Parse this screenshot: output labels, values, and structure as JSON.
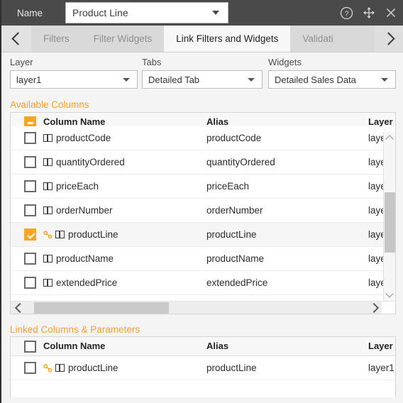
{
  "titlebar": {
    "name_label": "Name",
    "name_value": "Product Line",
    "help_icon": "help-circle-icon",
    "move_icon": "move-arrows-icon",
    "close_icon": "close-icon"
  },
  "tabstrip": {
    "prev_icon": "chevron-left-icon",
    "next_icon": "chevron-right-icon",
    "tabs": [
      {
        "label": "Filters",
        "active": false
      },
      {
        "label": "Filter Widgets",
        "active": false
      },
      {
        "label": "Link Filters and Widgets",
        "active": true
      },
      {
        "label": "Validati",
        "active": false
      }
    ]
  },
  "selectors": {
    "layer": {
      "label": "Layer",
      "value": "layer1"
    },
    "tabs": {
      "label": "Tabs",
      "value": "Detailed Tab"
    },
    "widgets": {
      "label": "Widgets",
      "value": "Detailed Sales Data"
    }
  },
  "available": {
    "section_title": "Available Columns",
    "header": {
      "checkbox_state": "indeterminate",
      "column_name": "Column Name",
      "alias": "Alias",
      "layer": "Layer"
    },
    "rows": [
      {
        "name": "productCode",
        "alias": "productCode",
        "layer": "laye",
        "checked": false,
        "linked": false,
        "selected": false
      },
      {
        "name": "quantityOrdered",
        "alias": "quantityOrdered",
        "layer": "laye",
        "checked": false,
        "linked": false,
        "selected": false
      },
      {
        "name": "priceEach",
        "alias": "priceEach",
        "layer": "laye",
        "checked": false,
        "linked": false,
        "selected": false
      },
      {
        "name": "orderNumber",
        "alias": "orderNumber",
        "layer": "laye",
        "checked": false,
        "linked": false,
        "selected": false
      },
      {
        "name": "productLine",
        "alias": "productLine",
        "layer": "laye",
        "checked": true,
        "linked": true,
        "selected": true
      },
      {
        "name": "productName",
        "alias": "productName",
        "layer": "laye",
        "checked": false,
        "linked": false,
        "selected": false
      },
      {
        "name": "extendedPrice",
        "alias": "extendedPrice",
        "layer": "laye",
        "checked": false,
        "linked": false,
        "selected": false
      }
    ]
  },
  "linked": {
    "section_title": "Linked Columns & Parameters",
    "header": {
      "checkbox_state": "unchecked",
      "column_name": "Column Name",
      "alias": "Alias",
      "layer": "Layer"
    },
    "rows": [
      {
        "name": "productLine",
        "alias": "productLine",
        "layer": "layer1",
        "checked": false,
        "linked": true,
        "selected": false
      }
    ]
  },
  "colors": {
    "accent": "#f5a623",
    "titlebar_bg": "#4a4a4a",
    "tab_bg": "#d9d9d9",
    "active_tab_bg": "#f7f7f7",
    "section_title": "#f0a02e"
  }
}
